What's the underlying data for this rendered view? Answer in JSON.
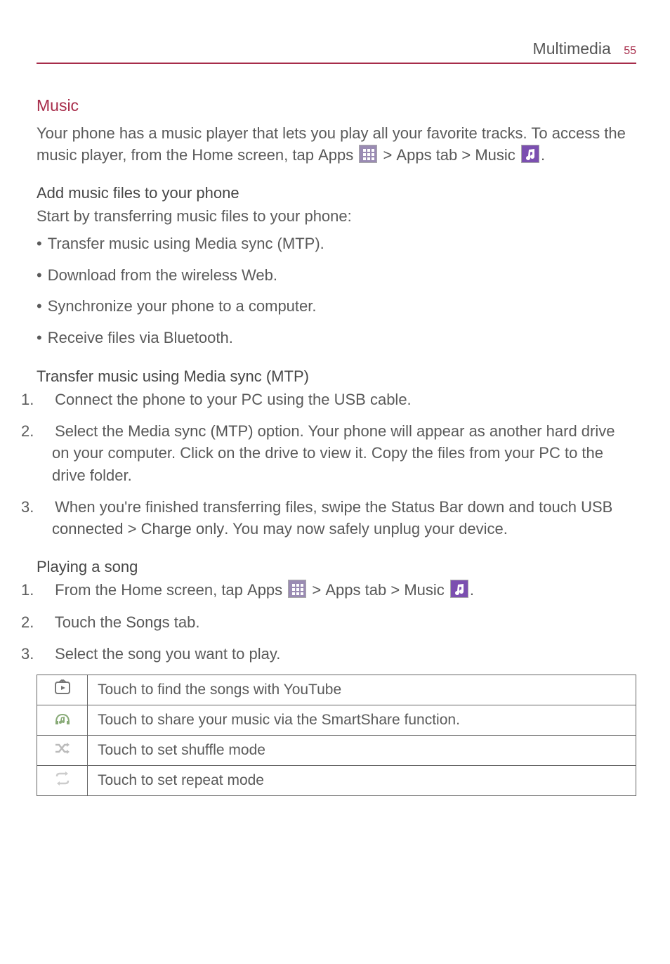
{
  "header": {
    "title": "Multimedia",
    "page": "55"
  },
  "music": {
    "heading": "Music",
    "intro_part1": "Your phone has a music player that lets you play all your favorite tracks. To access the music player, from the Home screen, tap ",
    "apps_label": "Apps",
    "gt": " > ",
    "apps_tab": "Apps",
    "tab_word": " tab > ",
    "music_label": "Music",
    "period": "."
  },
  "add": {
    "heading": "Add music files to your phone",
    "intro": "Start by transferring music files to your phone:",
    "bullets": [
      "Transfer music using Media sync (MTP).",
      "Download from the wireless Web.",
      "Synchronize your phone to a computer.",
      "Receive files via Bluetooth."
    ]
  },
  "transfer": {
    "heading": "Transfer music using Media sync (MTP)",
    "step1": "Connect the phone to your PC using the USB cable.",
    "step2_a": "Select the ",
    "step2_b": "Media sync (MTP)",
    "step2_c": " option. Your phone will appear as another hard drive on your computer. Click on the drive to view it. Copy the files from your PC to the drive folder.",
    "step3_a": "When you're finished transferring files, swipe the Status Bar down and touch ",
    "step3_b": "USB connected",
    "step3_c": " > ",
    "step3_d": "Charge only",
    "step3_e": ". You may now safely unplug your device."
  },
  "play": {
    "heading": "Playing a song",
    "step1_a": "From the Home screen, tap ",
    "apps_label": "Apps",
    "gt": " > ",
    "apps_tab": "Apps",
    "tab_word": " tab > ",
    "music_label": "Music",
    "period": ".",
    "step2_a": "Touch the ",
    "step2_b": "Songs",
    "step2_c": " tab.",
    "step3": "Select the song you want to play."
  },
  "table": {
    "rows": [
      {
        "icon": "youtube",
        "text": "Touch to find the songs with YouTube"
      },
      {
        "icon": "smartshare",
        "text": "Touch to share your music via the SmartShare function."
      },
      {
        "icon": "shuffle",
        "text": "Touch to set shuffle mode"
      },
      {
        "icon": "repeat",
        "text": "Touch to set repeat mode"
      }
    ]
  }
}
